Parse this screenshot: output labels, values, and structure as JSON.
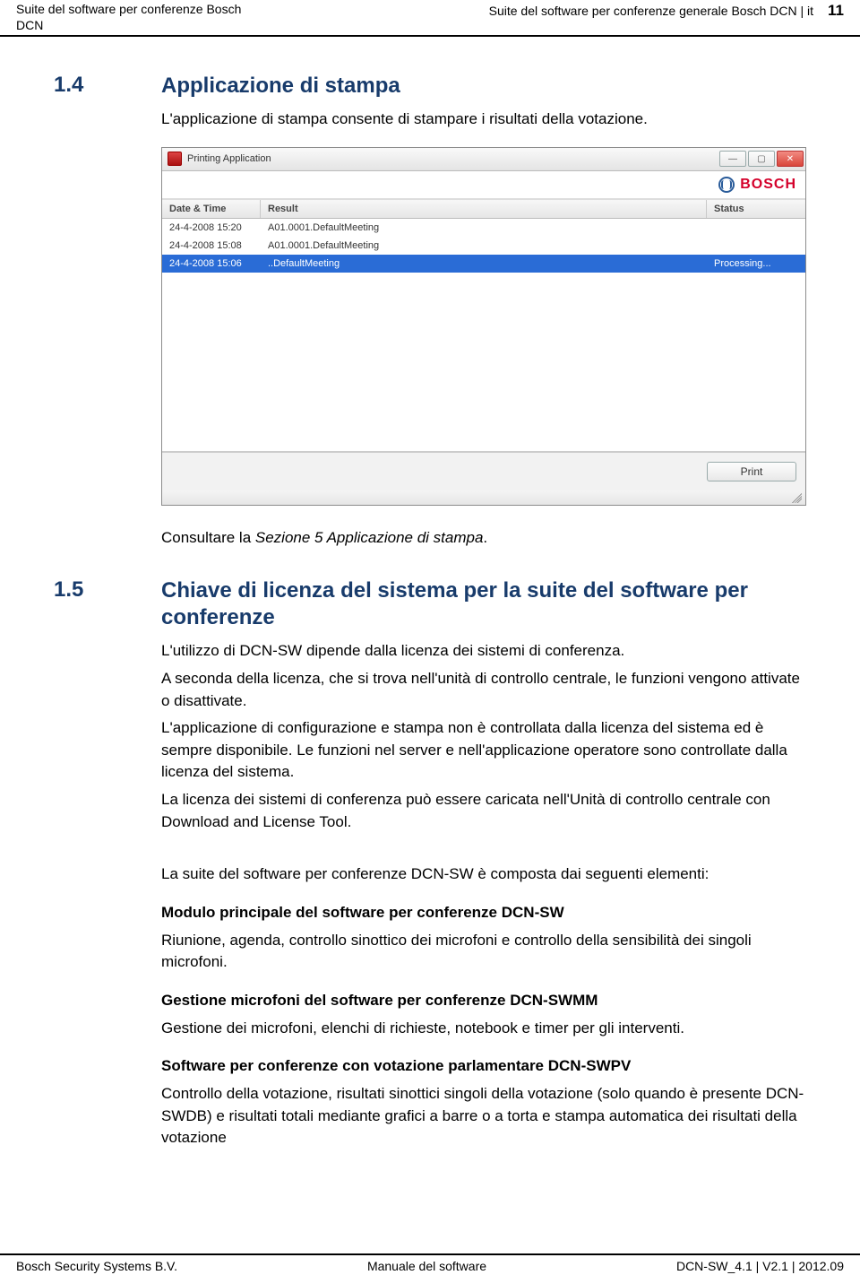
{
  "header": {
    "left_line1": "Suite del software per conferenze Bosch",
    "left_line2": "DCN",
    "right_text": "Suite del software per conferenze generale Bosch DCN | it",
    "page_num": "11"
  },
  "section_1_4": {
    "num": "1.4",
    "title": "Applicazione di stampa",
    "intro": "L'applicazione di stampa consente di stampare i risultati della votazione."
  },
  "screenshot": {
    "window_title": "Printing Application",
    "brand": "BOSCH",
    "columns": {
      "date": "Date & Time",
      "result": "Result",
      "status": "Status"
    },
    "rows": [
      {
        "date": "24-4-2008 15:20",
        "result": "A01.0001.DefaultMeeting",
        "status": "",
        "selected": false
      },
      {
        "date": "24-4-2008 15:08",
        "result": "A01.0001.DefaultMeeting",
        "status": "",
        "selected": false
      },
      {
        "date": "24-4-2008 15:06",
        "result": "..DefaultMeeting",
        "status": "Processing...",
        "selected": true
      }
    ],
    "print_label": "Print",
    "win_min": "—",
    "win_max": "▢",
    "win_close": "✕"
  },
  "consult": {
    "pre": "Consultare la ",
    "ital": "Sezione 5 Applicazione di stampa",
    "post": "."
  },
  "section_1_5": {
    "num": "1.5",
    "title": "Chiave di licenza del sistema per la suite del software per conferenze",
    "p1": "L'utilizzo di DCN-SW dipende dalla licenza dei sistemi di conferenza.",
    "p2": "A seconda della licenza, che si trova nell'unità di controllo centrale, le funzioni vengono attivate o disattivate.",
    "p3": "L'applicazione di configurazione e stampa non è controllata dalla licenza del sistema ed è sempre disponibile. Le funzioni nel server e nell'applicazione operatore sono controllate dalla licenza del sistema.",
    "p4": "La licenza dei sistemi di conferenza può essere caricata nell'Unità di controllo centrale con Download and License Tool.",
    "p5": "La suite del software per conferenze DCN-SW è composta dai seguenti elementi:",
    "mod1_h": "Modulo principale del software per conferenze DCN-SW",
    "mod1_b": "Riunione, agenda, controllo sinottico dei microfoni e controllo della sensibilità dei singoli microfoni.",
    "mod2_h": "Gestione microfoni del software per conferenze DCN-SWMM",
    "mod2_b": "Gestione dei microfoni, elenchi di richieste, notebook e timer per gli interventi.",
    "mod3_h": "Software per conferenze con votazione parlamentare DCN-SWPV",
    "mod3_b": "Controllo della votazione, risultati sinottici singoli della votazione (solo quando è presente DCN-SWDB) e risultati totali mediante grafici a barre o a torta e stampa automatica dei risultati della votazione"
  },
  "footer": {
    "left": "Bosch Security Systems B.V.",
    "center": "Manuale del software",
    "right": "DCN-SW_4.1 | V2.1 | 2012.09"
  }
}
